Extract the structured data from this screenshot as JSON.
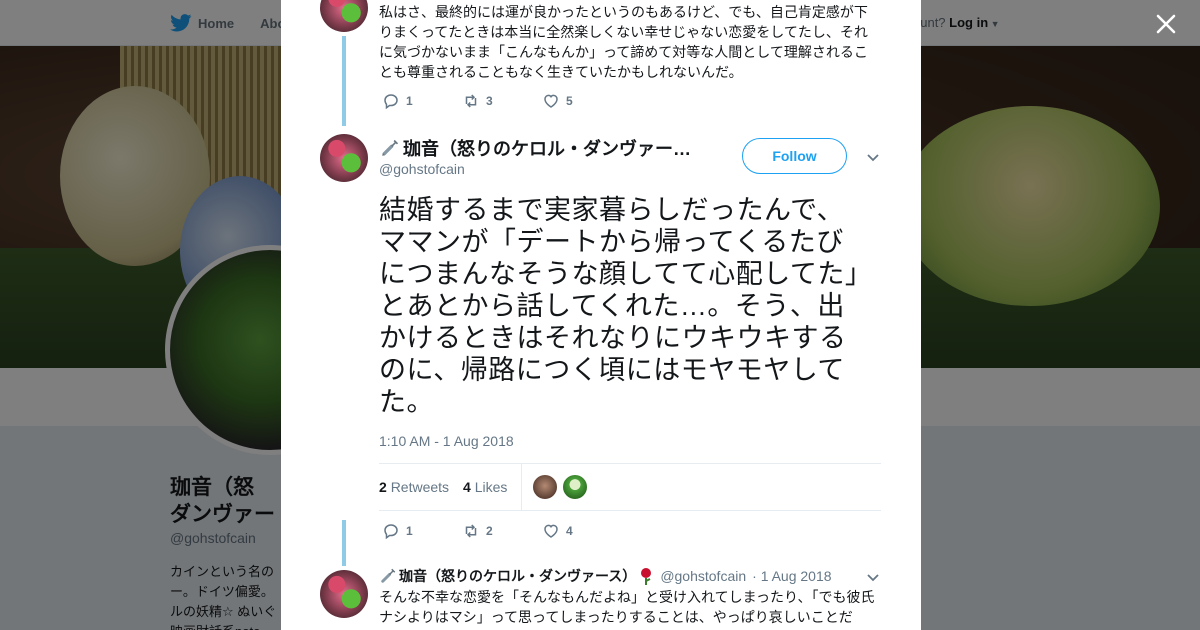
{
  "background": {
    "nav": {
      "home_label": "Home",
      "about_label": "Abo",
      "account_prompt": "ccount?",
      "login_label": "Log in"
    },
    "profile": {
      "name": "珈音（怒",
      "name_line2": "ダンヴァー",
      "handle": "@gohstofcain",
      "bio": "カインという名の ー。ドイツ偏愛。 ルの妖精☆ ぬいぐ 映画財話系note"
    }
  },
  "modal": {
    "previous_tweet": {
      "text": "私はさ、最終的には運が良かったというのもあるけど、でも、自己肯定感が下りまくってたときは本当に全然楽しくない幸せじゃない恋愛をしてたし、それに気づかないまま「こんなもんか」って諦めて対等な人間として理解されることも尊重されることもなく生きていたかもしれないんだ。",
      "reply_count": "1",
      "retweet_count": "3",
      "like_count": "5"
    },
    "main_tweet": {
      "display_name": "珈音（怒りのケロル・ダンヴァー…",
      "handle": "@gohstofcain",
      "follow_label": "Follow",
      "text": "結婚するまで実家暮らしだったんで、ママンが「デートから帰ってくるたびにつまんなそうな顔してて心配してた」とあとから話してくれた…。そう、出かけるときはそれなりにウキウキするのに、帰路につく頃にはモヤモヤしてた。",
      "timestamp": "1:10 AM - 1 Aug 2018",
      "retweets_number": "2",
      "retweets_label": "Retweets",
      "likes_number": "4",
      "likes_label": "Likes",
      "reply_count": "1",
      "retweet_count": "2",
      "like_count": "4"
    },
    "reply_tweet": {
      "display_name": "珈音（怒りのケロル・ダンヴァース）",
      "handle": "@gohstofcain",
      "date": "· 1 Aug 2018",
      "text": "そんな不幸な恋愛を「そんなもんだよね」と受け入れてしまったり、「でも彼氏ナシよりはマシ」って思ってしまったりすることは、やっぱり哀しいことだ"
    }
  },
  "icons": {
    "accent": "#1da1f2",
    "thread_line": "#8fcae6",
    "muted": "#657786"
  }
}
